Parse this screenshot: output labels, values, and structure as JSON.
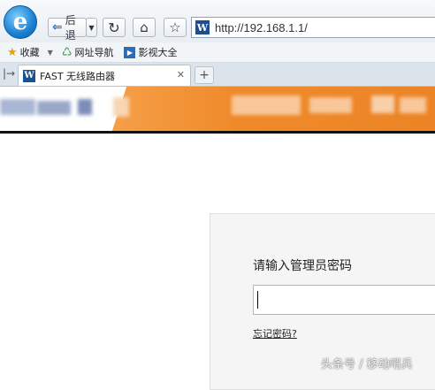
{
  "toolbar": {
    "ie_logo": "e",
    "back_label": "后退",
    "url": "http://192.168.1.1/"
  },
  "bookmarks": [
    {
      "label": "收藏",
      "icon": "star-icon"
    },
    {
      "label": "网址导航",
      "icon": "web-nav-icon"
    },
    {
      "label": "影视大全",
      "icon": "video-icon"
    }
  ],
  "tab": {
    "title": "FAST 无线路由器",
    "favicon": "W"
  },
  "login": {
    "title": "请输入管理员密码",
    "password_value": "",
    "forgot_label": "忘记密码?"
  },
  "watermark": "头条号 / 移动哨兵",
  "colors": {
    "banner_orange": "#ef8a2a",
    "link_blue": "#2b7ad8"
  }
}
